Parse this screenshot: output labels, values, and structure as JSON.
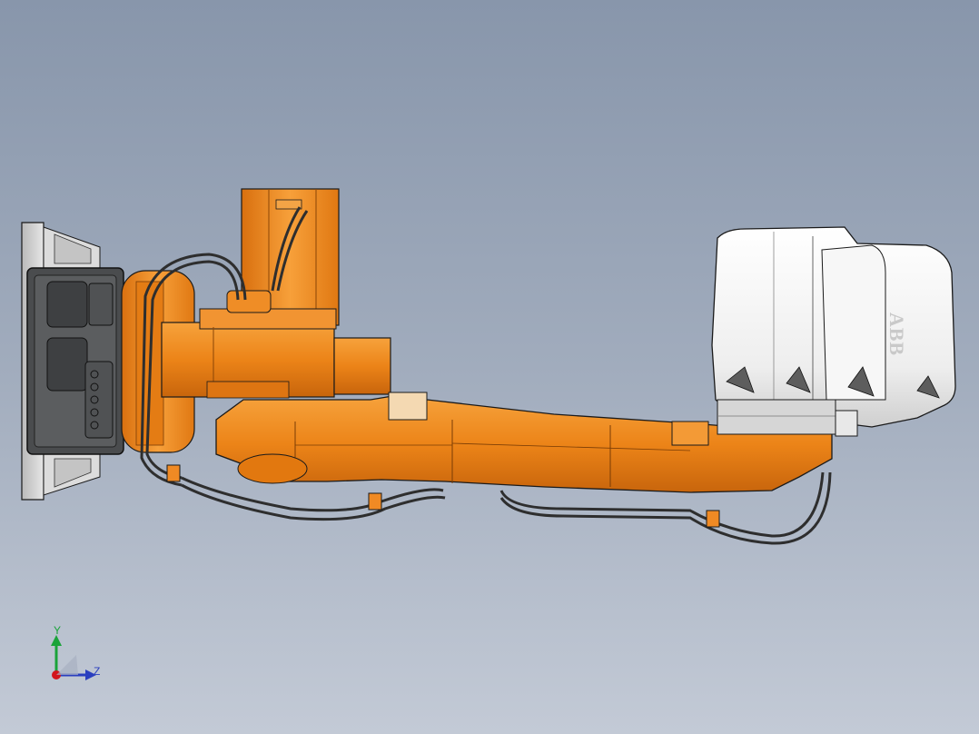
{
  "viewport": {
    "background_top": "#8896ab",
    "background_bottom": "#c3cad6"
  },
  "model": {
    "brand_label": "ABB",
    "body_color": "#ef8a1e",
    "cover_color": "#f2f2f2",
    "cable_color": "#2e2e2e"
  },
  "triad": {
    "y_label": "Y",
    "z_label": "Z",
    "y_color": "#1aa33a",
    "z_color": "#2a3fbf",
    "x_color": "#d3141c"
  }
}
